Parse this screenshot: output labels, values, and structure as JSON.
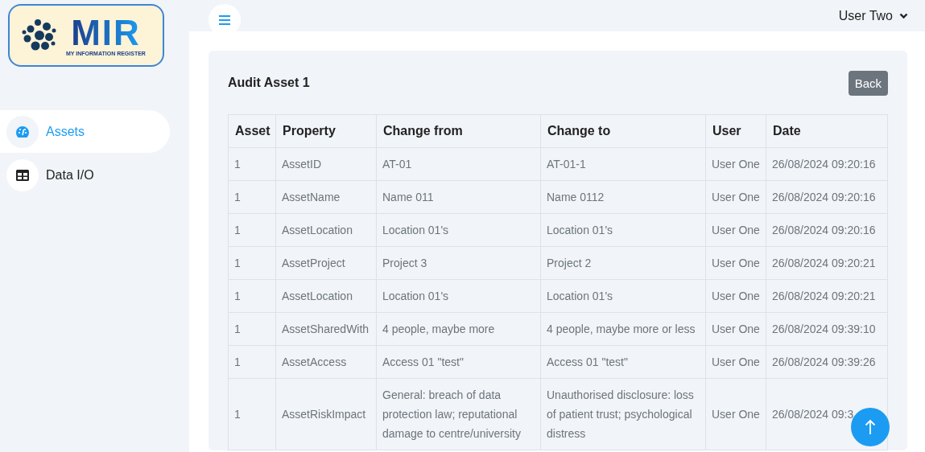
{
  "logo": {
    "title": "MIR",
    "subtitle": "MY INFORMATION REGISTER"
  },
  "sidebar": {
    "items": [
      {
        "label": "Assets",
        "selected": true
      },
      {
        "label": "Data I/O",
        "selected": false
      }
    ]
  },
  "topbar": {
    "user": "User Two"
  },
  "card": {
    "title": "Audit Asset 1",
    "back_button": "Back"
  },
  "table": {
    "columns": [
      "Asset",
      "Property",
      "Change from",
      "Change to",
      "User",
      "Date"
    ],
    "rows": [
      [
        "1",
        "AssetID",
        "AT-01",
        "AT-01-1",
        "User One",
        "26/08/2024 09:20:16"
      ],
      [
        "1",
        "AssetName",
        "Name 011",
        "Name 0112",
        "User One",
        "26/08/2024 09:20:16"
      ],
      [
        "1",
        "AssetLocation",
        "Location 01's",
        "Location 01's",
        "User One",
        "26/08/2024 09:20:16"
      ],
      [
        "1",
        "AssetProject",
        "Project 3",
        "Project 2",
        "User One",
        "26/08/2024 09:20:21"
      ],
      [
        "1",
        "AssetLocation",
        "Location 01's",
        "Location 01's",
        "User One",
        "26/08/2024 09:20:21"
      ],
      [
        "1",
        "AssetSharedWith",
        "4 people, maybe more",
        "4 people, maybe more or less",
        "User One",
        "26/08/2024 09:39:10"
      ],
      [
        "1",
        "AssetAccess",
        "Access 01 \"test\"",
        "Access 01 \"test\"",
        "User One",
        "26/08/2024 09:39:26"
      ],
      [
        "1",
        "AssetRiskImpact",
        "General: breach of data protection law; reputational damage to centre/university",
        "Unauthorised disclosure: loss of patient trust; psychological distress",
        "User One",
        "26/08/2024 09:3"
      ]
    ]
  }
}
